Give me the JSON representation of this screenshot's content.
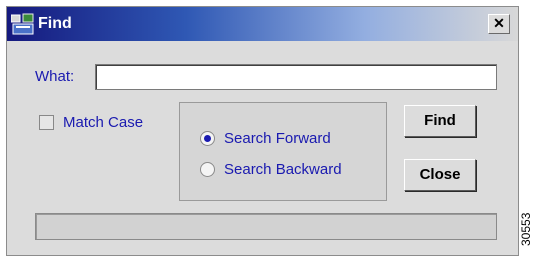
{
  "window": {
    "title": "Find",
    "close_glyph": "✕",
    "icon": "find-window-icon"
  },
  "what": {
    "label": "What:",
    "value": "",
    "placeholder": ""
  },
  "match_case": {
    "label": "Match Case",
    "checked": false
  },
  "direction": {
    "options": [
      {
        "label": "Search Forward",
        "selected": true
      },
      {
        "label": "Search Backward",
        "selected": false
      }
    ]
  },
  "buttons": {
    "find": "Find",
    "close": "Close"
  },
  "status": {
    "text": ""
  },
  "side_id": "30553",
  "colors": {
    "label_text": "#1a1ab0",
    "title_gradient_start": "#15197e",
    "title_gradient_end": "#d8d8d8",
    "window_bg": "#dcdcdc"
  }
}
